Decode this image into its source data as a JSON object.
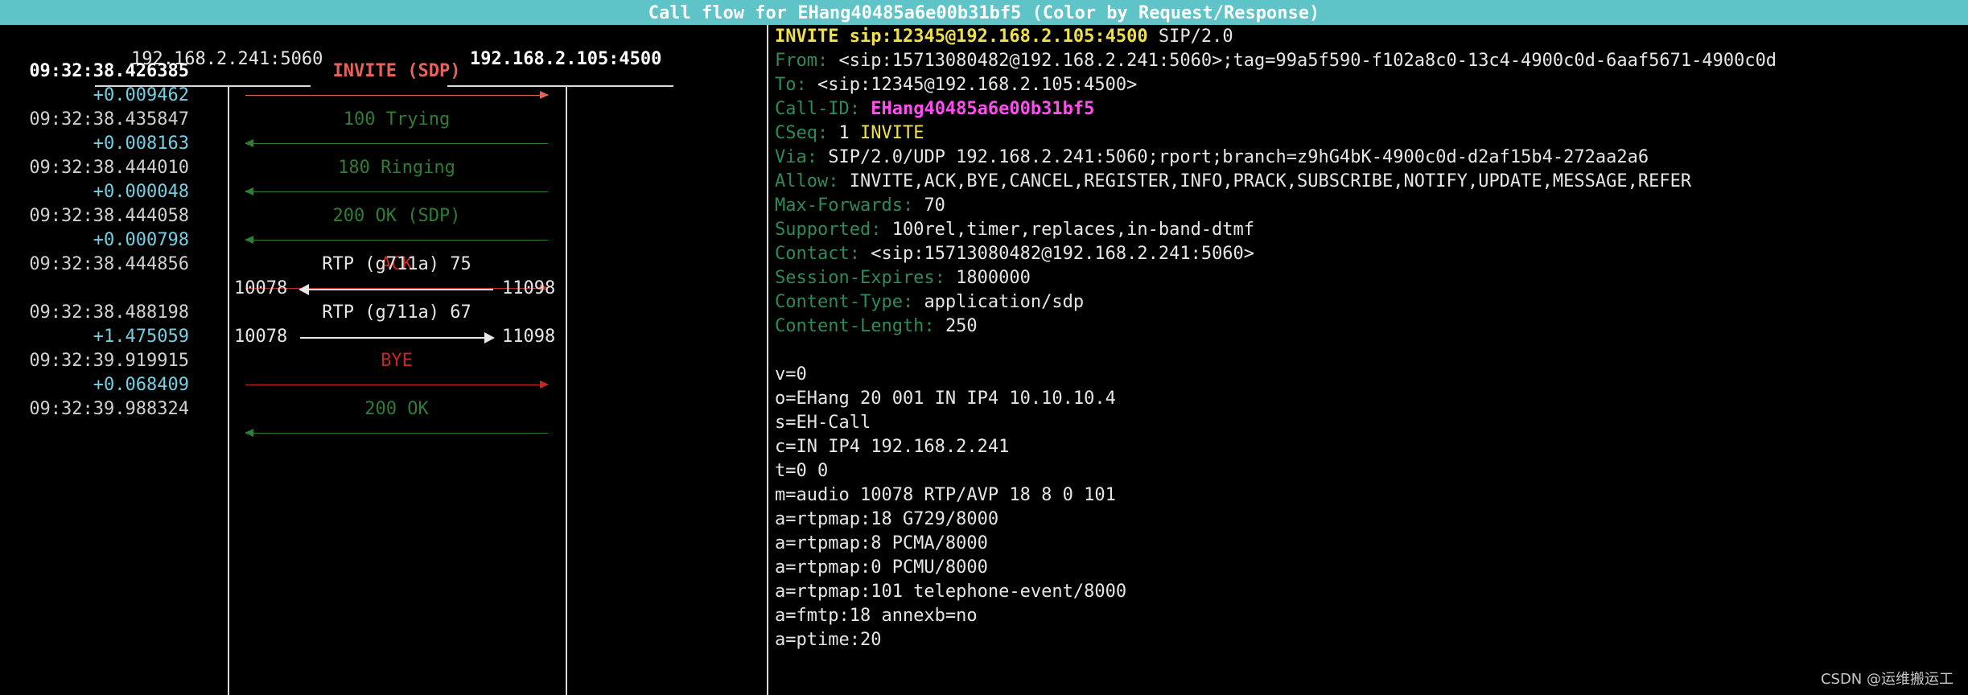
{
  "title": "Call flow for EHang40485a6e00b31bf5 (Color by Request/Response)",
  "hosts": {
    "left": "192.168.2.241:5060",
    "right": "192.168.2.105:4500"
  },
  "timestamps": [
    {
      "text": "09:32:38.426385",
      "kind": "bold"
    },
    {
      "text": "+0.009462",
      "kind": "delta"
    },
    {
      "text": "09:32:38.435847",
      "kind": "normal"
    },
    {
      "text": "+0.008163",
      "kind": "delta"
    },
    {
      "text": "09:32:38.444010",
      "kind": "normal"
    },
    {
      "text": "+0.000048",
      "kind": "delta"
    },
    {
      "text": "09:32:38.444058",
      "kind": "normal"
    },
    {
      "text": "+0.000798",
      "kind": "delta"
    },
    {
      "text": "09:32:38.444856",
      "kind": "normal"
    },
    {
      "text": "09:32:38.488198",
      "kind": "normal"
    },
    {
      "text": "+1.475059",
      "kind": "delta"
    },
    {
      "text": "09:32:39.919915",
      "kind": "normal"
    },
    {
      "text": "+0.068409",
      "kind": "delta"
    },
    {
      "text": "09:32:39.988324",
      "kind": "normal"
    }
  ],
  "messages": [
    {
      "label": "INVITE (SDP)",
      "dir": "right",
      "color": "#e8625c",
      "selected": true
    },
    {
      "label": "100 Trying",
      "dir": "left",
      "color": "#2e7d32"
    },
    {
      "label": "180 Ringing",
      "dir": "left",
      "color": "#2e7d32"
    },
    {
      "label": "200 OK (SDP)",
      "dir": "left",
      "color": "#2e7d32"
    },
    {
      "label": "ACK",
      "dir": "right",
      "color": "#c62828"
    },
    {
      "label": "BYE",
      "dir": "right",
      "color": "#c62828"
    },
    {
      "label": "200 OK",
      "dir": "left",
      "color": "#2e7d32"
    }
  ],
  "rtp": [
    {
      "label": "RTP (g711a) 75",
      "left_port": "10078",
      "right_port": "11098",
      "dir": "left"
    },
    {
      "label": "RTP (g711a) 67",
      "left_port": "10078",
      "right_port": "11098",
      "dir": "right"
    }
  ],
  "sip": {
    "request_method": "INVITE",
    "request_uri": "sip:12345@192.168.2.105:4500",
    "request_version": "SIP/2.0",
    "from_key": "From:",
    "from_val": "<sip:15713080482@192.168.2.241:5060>;tag=99a5f590-f102a8c0-13c4-4900c0d-6aaf5671-4900c0d",
    "to_key": "To:",
    "to_val": "<sip:12345@192.168.2.105:4500>",
    "callid_key": "Call-ID:",
    "callid_val": "EHang40485a6e00b31bf5",
    "cseq_key": "CSeq:",
    "cseq_num": "1",
    "cseq_method": "INVITE",
    "via_key": "Via:",
    "via_val": "SIP/2.0/UDP 192.168.2.241:5060;rport;branch=z9hG4bK-4900c0d-d2af15b4-272aa2a6",
    "allow_key": "Allow:",
    "allow_val": "INVITE,ACK,BYE,CANCEL,REGISTER,INFO,PRACK,SUBSCRIBE,NOTIFY,UPDATE,MESSAGE,REFER",
    "maxfwd_key": "Max-Forwards:",
    "maxfwd_val": "70",
    "supported_key": "Supported:",
    "supported_val": "100rel,timer,replaces,in-band-dtmf",
    "contact_key": "Contact:",
    "contact_val": "<sip:15713080482@192.168.2.241:5060>",
    "session_key": "Session-Expires:",
    "session_val": "1800000",
    "ctype_key": "Content-Type:",
    "ctype_val": "application/sdp",
    "clen_key": "Content-Length:",
    "clen_val": "250"
  },
  "sdp": [
    "v=0",
    "o=EHang 20 001 IN IP4 10.10.10.4",
    "s=EH-Call",
    "c=IN IP4 192.168.2.241",
    "t=0 0",
    "m=audio 10078 RTP/AVP 18 8 0 101",
    "a=rtpmap:18 G729/8000",
    "a=rtpmap:8 PCMA/8000",
    "a=rtpmap:0 PCMU/8000",
    "a=rtpmap:101 telephone-event/8000",
    "a=fmtp:18 annexb=no",
    "a=ptime:20"
  ],
  "watermark": "CSDN @运维搬运工"
}
